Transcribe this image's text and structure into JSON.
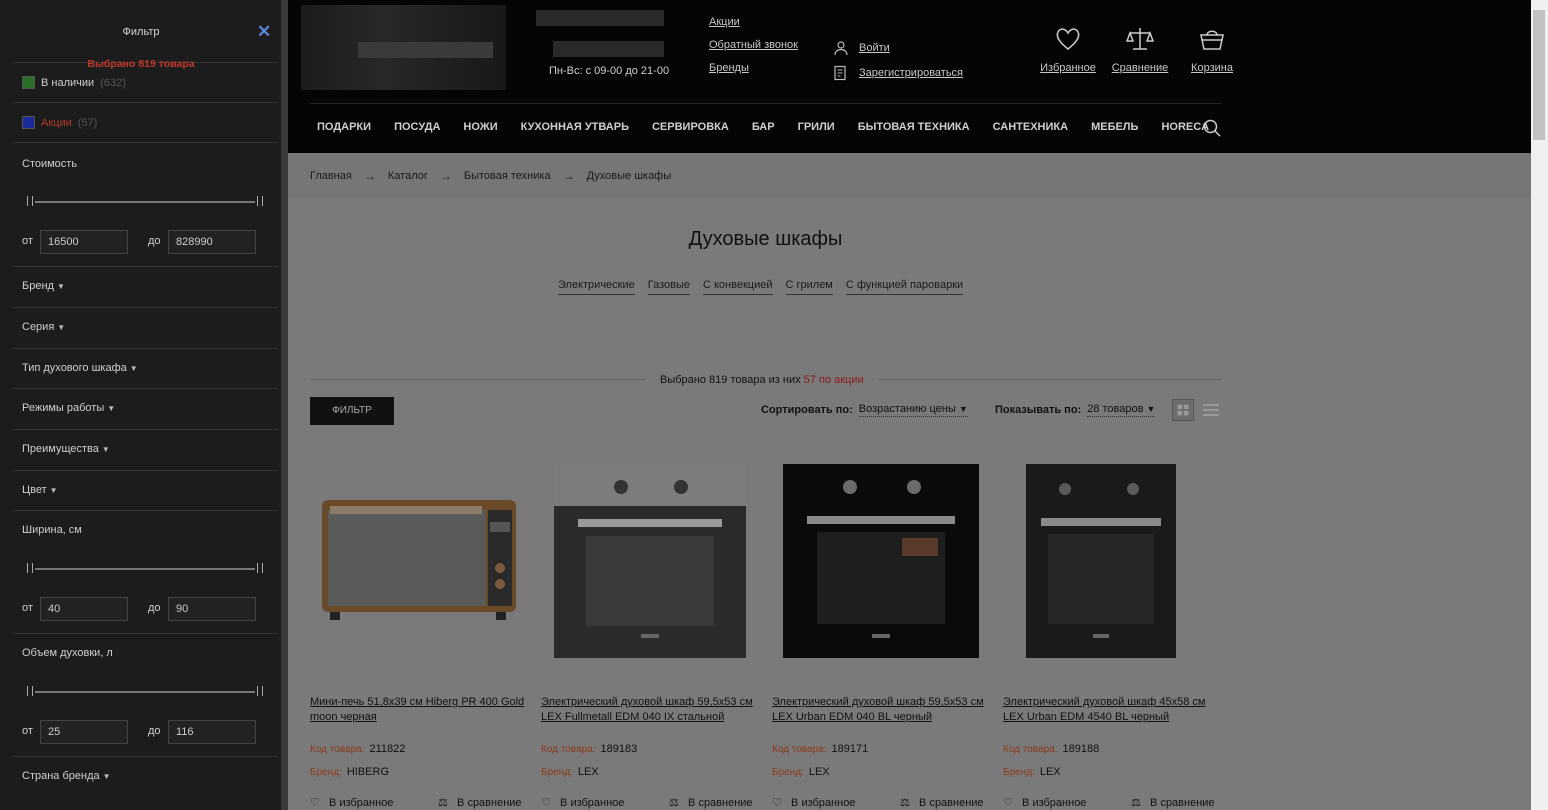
{
  "sidebar": {
    "title": "Фильтр",
    "selected_text": "Выбрано 819 товара",
    "in_stock": {
      "label": "В наличии",
      "count": "(632)"
    },
    "promo": {
      "label": "Акции",
      "count": "(57)"
    },
    "price": {
      "heading": "Стоимость",
      "from_label": "от",
      "to_label": "до",
      "from": "16500",
      "to": "828990"
    },
    "brand": "Бренд",
    "series": "Серия",
    "oven_type": "Тип духового шкафа",
    "modes": "Режимы работы",
    "advantages": "Преимущества",
    "color": "Цвет",
    "width": {
      "heading": "Ширина, см",
      "from_label": "от",
      "to_label": "до",
      "from": "40",
      "to": "90"
    },
    "volume": {
      "heading": "Объем духовки, л",
      "from_label": "от",
      "to_label": "до",
      "from": "25",
      "to": "116"
    },
    "brand_country": "Страна бренда"
  },
  "header": {
    "hours": "Пн-Вс: с 09-00 до 21-00",
    "links": [
      "Акции",
      "Обратный звонок",
      "Бренды"
    ],
    "login": "Войти",
    "register": "Зарегистрироваться",
    "favorites": "Избранное",
    "compare": "Сравнение",
    "cart": "Корзина",
    "nav": [
      "ПОДАРКИ",
      "ПОСУДА",
      "НОЖИ",
      "КУХОННАЯ УТВАРЬ",
      "СЕРВИРОВКА",
      "БАР",
      "ГРИЛИ",
      "БЫТОВАЯ ТЕХНИКА",
      "САНТЕХНИКА",
      "МЕБЕЛЬ",
      "HORECA"
    ]
  },
  "breadcrumb": [
    "Главная",
    "Каталог",
    "Бытовая техника",
    "Духовые шкафы"
  ],
  "breadcrumb_sep": "→",
  "page": {
    "title": "Духовые шкафы",
    "subcategories": [
      "Электрические",
      "Газовые",
      "С конвекцией",
      "С грилем",
      "С функцией пароварки"
    ],
    "selected_prefix": "Выбрано",
    "selected_count": "819 товара",
    "selected_mid": "из них",
    "selected_promo": "57 по акции",
    "filter_button": "ФИЛЬТР",
    "sort_label": "Сортировать по:",
    "sort_value": "Возрастанию цены",
    "show_label": "Показывать по:",
    "show_value": "28 товаров"
  },
  "products": [
    {
      "name": "Мини-печь 51,8x39 см Hiberg PR 400 Gold moon черная",
      "code_label": "Код товара:",
      "code": "211822",
      "brand_label": "Бренд:",
      "brand": "HIBERG",
      "fav": "В избранное",
      "compare": "В сравнение"
    },
    {
      "name": "Электрический духовой шкаф 59,5x53 см LEX Fullmetall EDM 040 IX стальной",
      "code_label": "Код товара:",
      "code": "189183",
      "brand_label": "Бренд:",
      "brand": "LEX",
      "fav": "В избранное",
      "compare": "В сравнение"
    },
    {
      "name": "Электрический духовой шкаф 59,5x53 см LEX Urban EDM 040 BL черный",
      "code_label": "Код товара:",
      "code": "189171",
      "brand_label": "Бренд:",
      "brand": "LEX",
      "fav": "В избранное",
      "compare": "В сравнение"
    },
    {
      "name": "Электрический духовой шкаф 45x58 см LEX Urban EDM 4540 BL черный",
      "code_label": "Код товара:",
      "code": "189188",
      "brand_label": "Бренд:",
      "brand": "LEX",
      "fav": "В избранное",
      "compare": "В сравнение"
    }
  ]
}
